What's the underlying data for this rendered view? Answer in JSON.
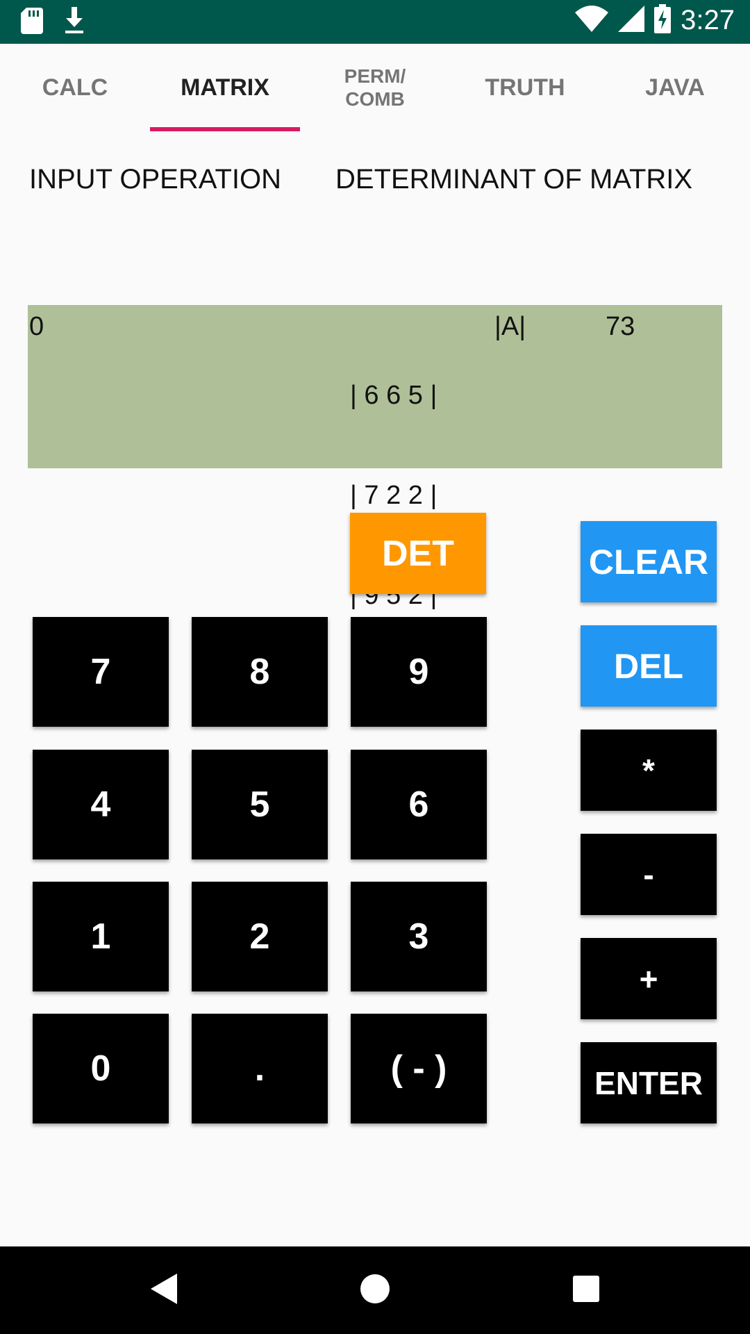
{
  "status_bar": {
    "time": "3:27",
    "icons": [
      "sd-card-icon",
      "download-icon",
      "wifi-icon",
      "signal-icon",
      "battery-charging-icon"
    ],
    "background": "#00574B"
  },
  "tabs": [
    {
      "label": "CALC",
      "active": false
    },
    {
      "label": "MATRIX",
      "active": true
    },
    {
      "label": "PERM/\nCOMB",
      "active": false
    },
    {
      "label": "TRUTH",
      "active": false
    },
    {
      "label": "JAVA",
      "active": false
    }
  ],
  "accent_color": "#D81B60",
  "labels": {
    "input_operation": "INPUT OPERATION",
    "operation_name": "DETERMINANT OF MATRIX"
  },
  "display": {
    "input": "0",
    "matrix_rows": [
      "| 6 6 5 |",
      "| 7 2 2 |",
      "| 9 5 2 |"
    ],
    "det_label": "|A|",
    "det_value": "73",
    "background": "#AFC098"
  },
  "keypad": {
    "det": "DET",
    "digits": [
      "7",
      "8",
      "9",
      "4",
      "5",
      "6",
      "1",
      "2",
      "3",
      "0",
      ".",
      "( - )"
    ]
  },
  "operators": {
    "clear": "CLEAR",
    "del": "DEL",
    "multiply": "*",
    "minus": "-",
    "plus": "+",
    "enter": "ENTER"
  },
  "colors": {
    "det_button": "#FF9800",
    "clear_del_buttons": "#2196F3",
    "keys": "#000000"
  },
  "nav_bar": {
    "icons": [
      "back-icon",
      "home-icon",
      "recents-icon"
    ]
  }
}
